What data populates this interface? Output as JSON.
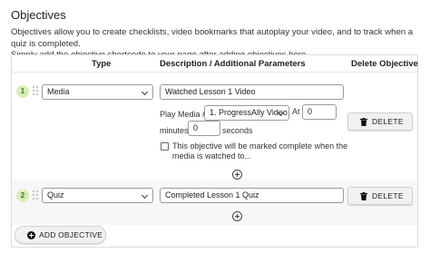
{
  "page": {
    "title": "Objectives",
    "intro_line1": "Objectives allow you to create checklists, video bookmarks that autoplay your video, and to track when a quiz is completed.",
    "intro_line2": "Simply add the objective shortcode to your page after adding objectives here."
  },
  "table": {
    "col_type": "Type",
    "col_description": "Description / Additional Parameters",
    "col_delete": "Delete Objective"
  },
  "objectives": [
    {
      "number": "1",
      "type": "Media",
      "description": "Watched Lesson 1 Video",
      "play_media_label": "Play Media #",
      "media_select": "1. ProgressAlly Video",
      "at_label": "At",
      "at_value": "0",
      "minutes_label": "minutes",
      "seconds_value": "0",
      "seconds_label": "seconds",
      "checkbox_line1": "This objective will be marked complete when the",
      "checkbox_line2": "media is watched to...",
      "delete_label": "DELETE"
    },
    {
      "number": "2",
      "type": "Quiz",
      "description": "Completed Lesson 1 Quiz",
      "delete_label": "DELETE"
    }
  ],
  "add_button": "ADD OBJECTIVE",
  "colors": {
    "badge_bg": "#d6efb8",
    "badge_text": "#4a6d22",
    "button_bg": "#f1f1f1"
  }
}
